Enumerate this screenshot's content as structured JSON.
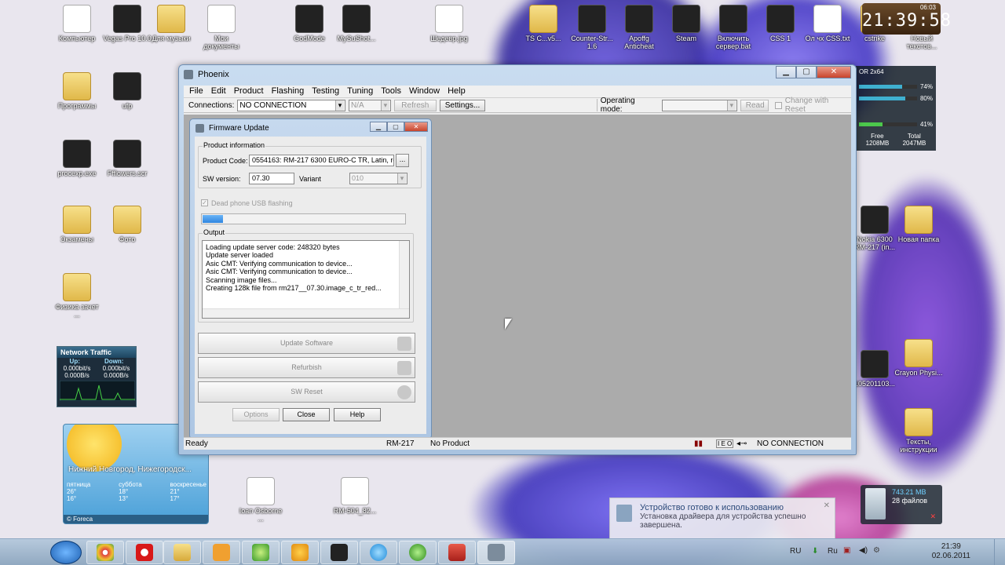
{
  "desktop": {
    "icons_left": [
      {
        "label": "Компьютер",
        "type": "computer"
      },
      {
        "label": "Vegas Pro 10.0",
        "type": "app"
      },
      {
        "label": "Для музыки",
        "type": "folder"
      },
      {
        "label": "Мои документы",
        "type": "doc"
      },
      {
        "label": "Программы",
        "type": "folder"
      },
      {
        "label": "ufp",
        "type": "app"
      },
      {
        "label": "procexp.exe",
        "type": "app"
      },
      {
        "label": "Ffflowers.scr",
        "type": "app"
      },
      {
        "label": "Экзамены",
        "type": "folder"
      },
      {
        "label": "Фото",
        "type": "folder"
      },
      {
        "label": "Физика зачет ...",
        "type": "folder"
      }
    ],
    "icons_top": [
      {
        "label": "GodMode",
        "type": "app"
      },
      {
        "label": "MySuShot...",
        "type": "app"
      },
      {
        "label": "Шедевр.jpg",
        "type": "doc"
      },
      {
        "label": "TS C...v5...",
        "type": "folder"
      },
      {
        "label": "Counter-Str... 1.6",
        "type": "app"
      },
      {
        "label": "Apoffg Anticheat",
        "type": "app"
      },
      {
        "label": "Steam",
        "type": "app"
      },
      {
        "label": "Включить сервер.bat",
        "type": "app"
      },
      {
        "label": "CSS 1",
        "type": "app"
      },
      {
        "label": "Ол чх CSS.txt",
        "type": "doc"
      },
      {
        "label": "cstrike",
        "type": "folder"
      },
      {
        "label": "Новый текстов...",
        "type": "doc"
      }
    ],
    "icons_right": [
      {
        "label": "Nokia 6300 RM-217 (in...",
        "type": "app"
      },
      {
        "label": "Новая папка",
        "type": "folder"
      },
      {
        "label": "105201103...",
        "type": "app"
      },
      {
        "label": "Crayon Physi...",
        "type": "folder"
      },
      {
        "label": "Тексты, инструкции",
        "type": "folder"
      }
    ],
    "icons_bottom": [
      {
        "label": "Ioan Osborne ...",
        "type": "mp3"
      },
      {
        "label": "RM-504_82...",
        "type": "doc"
      }
    ]
  },
  "clock_gadget": {
    "time": "21:39:58",
    "small": "06:03"
  },
  "meter_gadget": {
    "title": "OR 2x64",
    "cpu1": "74%",
    "cpu2": "80%",
    "mem": "41%",
    "free_label": "Free",
    "total_label": "Total",
    "free": "1208MB",
    "total": "2047MB",
    "cpu1_level": 0.74,
    "cpu2_level": 0.8,
    "mem_level": 0.41
  },
  "net_gadget": {
    "title": "Network Traffic",
    "up": "Up:",
    "down": "Down:",
    "up_bits": "0.000bit/s",
    "down_bits": "0.000bit/s",
    "up_bytes": "0.000B/s",
    "down_bytes": "0.000B/s"
  },
  "weather_gadget": {
    "city": "Нижний Новгород, Нижегородск...",
    "days": [
      {
        "name": "пятница",
        "hi": "26°",
        "lo": "16°"
      },
      {
        "name": "суббота",
        "hi": "18°",
        "lo": "13°"
      },
      {
        "name": "воскресенье",
        "hi": "21°",
        "lo": "17°"
      }
    ],
    "brand": "© Foreca"
  },
  "recycle": {
    "size": "743.21 MB",
    "files": "28 файлов"
  },
  "notification": {
    "title": "Устройство готово к использованию",
    "text": "Установка драйвера для устройства успешно завершена."
  },
  "phoenix": {
    "title": "Phoenix",
    "menu": [
      "File",
      "Edit",
      "Product",
      "Flashing",
      "Testing",
      "Tuning",
      "Tools",
      "Window",
      "Help"
    ],
    "toolbar": {
      "connections_label": "Connections:",
      "connection_value": "NO CONNECTION",
      "na_value": "N/A",
      "refresh": "Refresh",
      "settings": "Settings...",
      "operating_mode_label": "Operating mode:",
      "read": "Read",
      "change_with_reset": "Change with Reset"
    },
    "status": {
      "ready": "Ready",
      "model": "RM-217",
      "product": "No Product",
      "connection": "NO CONNECTION"
    }
  },
  "firmware": {
    "title": "Firmware Update",
    "product_info_legend": "Product information",
    "product_code_label": "Product Code:",
    "product_code_value": "0554163: RM-217 6300 EURO-C TR, Latin, re",
    "browse": "...",
    "sw_version_label": "SW version:",
    "sw_version_value": "07.30",
    "variant_label": "Variant",
    "variant_value": "010",
    "dead_phone_label": "Dead phone USB flashing",
    "progress": 0.1,
    "output_legend": "Output",
    "output_lines": [
      "Loading update server code: 248320 bytes",
      "Update server loaded",
      "Asic CMT: Verifying communication to device...",
      "Asic CMT: Verifying communication to device...",
      "Scanning image files...",
      "Creating 128k file from rm217__07.30.image_c_tr_red..."
    ],
    "update_software": "Update Software",
    "refurbish": "Refurbish",
    "sw_reset": "SW Reset",
    "options": "Options",
    "close": "Close",
    "help": "Help"
  },
  "taskbar": {
    "lang": "RU",
    "time": "21:39",
    "date": "02.06.2011",
    "lang2": "Ru"
  }
}
